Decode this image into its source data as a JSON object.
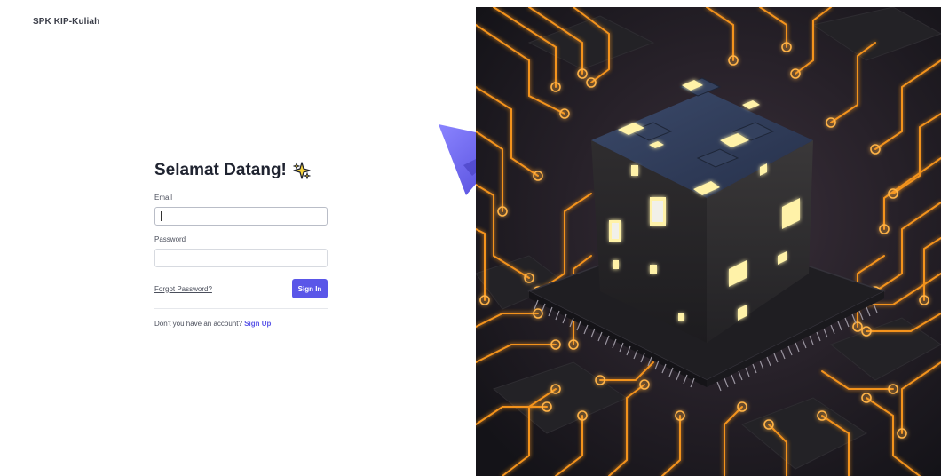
{
  "brand": {
    "name": "SPK KIP-Kuliah"
  },
  "login": {
    "title": "Selamat Datang!",
    "title_icon": "sparkle-icon",
    "email_label": "Email",
    "email_value": "",
    "password_label": "Password",
    "password_value": "",
    "forgot_label": "Forgot Password?",
    "signin_label": "Sign In",
    "signup_prompt": "Don't you have an account?",
    "signup_label": "Sign Up"
  },
  "decor": {
    "plane_icon": "paper-plane-icon",
    "hero_image": "circuit-cube-illustration"
  },
  "colors": {
    "accent": "#5a56e8",
    "plane": "#6b63f0",
    "circuit": "#ff9a1f",
    "glow": "#fff2a8"
  }
}
